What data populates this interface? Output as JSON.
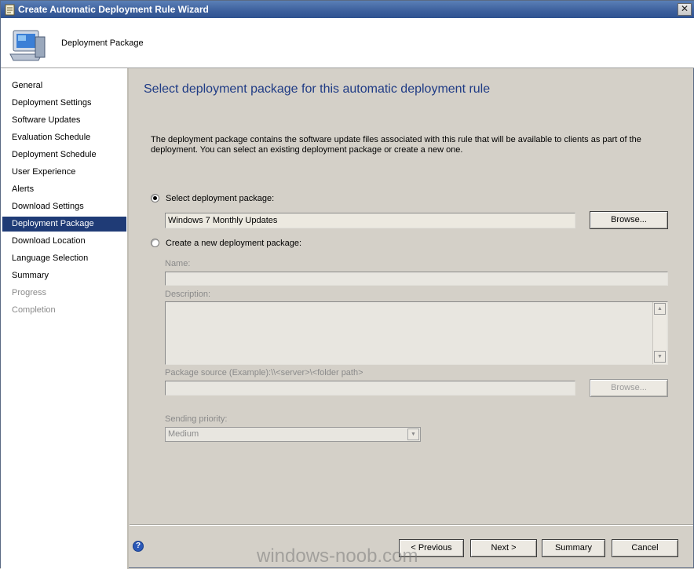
{
  "window": {
    "title": "Create Automatic Deployment Rule Wizard",
    "close_glyph": "✕"
  },
  "header": {
    "title": "Deployment Package",
    "icon": "computer-wizard-icon"
  },
  "nav": {
    "items": [
      {
        "label": "General",
        "state": "normal"
      },
      {
        "label": "Deployment Settings",
        "state": "normal"
      },
      {
        "label": "Software Updates",
        "state": "normal"
      },
      {
        "label": "Evaluation Schedule",
        "state": "normal"
      },
      {
        "label": "Deployment Schedule",
        "state": "normal"
      },
      {
        "label": "User Experience",
        "state": "normal"
      },
      {
        "label": "Alerts",
        "state": "normal"
      },
      {
        "label": "Download Settings",
        "state": "normal"
      },
      {
        "label": "Deployment Package",
        "state": "selected"
      },
      {
        "label": "Download Location",
        "state": "normal"
      },
      {
        "label": "Language Selection",
        "state": "normal"
      },
      {
        "label": "Summary",
        "state": "normal"
      },
      {
        "label": "Progress",
        "state": "disabled"
      },
      {
        "label": "Completion",
        "state": "disabled"
      }
    ]
  },
  "main": {
    "heading": "Select deployment package for this automatic deployment rule",
    "description": "The deployment package contains the software update files associated with this rule that will be available to clients as part of the deployment. You can select an existing deployment package or create a new one.",
    "select_existing": {
      "label": "Select deployment package:",
      "checked": true,
      "value": "Windows 7 Monthly Updates",
      "browse_label": "Browse..."
    },
    "create_new": {
      "label": "Create a new deployment package:",
      "checked": false,
      "name_label": "Name:",
      "name_value": "",
      "description_label": "Description:",
      "description_value": "",
      "source_label": "Package source (Example):\\\\<server>\\<folder path>",
      "source_value": "",
      "browse_label": "Browse...",
      "priority_label": "Sending priority:",
      "priority_value": "Medium"
    }
  },
  "footer": {
    "help_glyph": "?",
    "previous_label": "< Previous",
    "next_label": "Next >",
    "summary_label": "Summary",
    "cancel_label": "Cancel"
  },
  "watermark": "windows-noob.com"
}
